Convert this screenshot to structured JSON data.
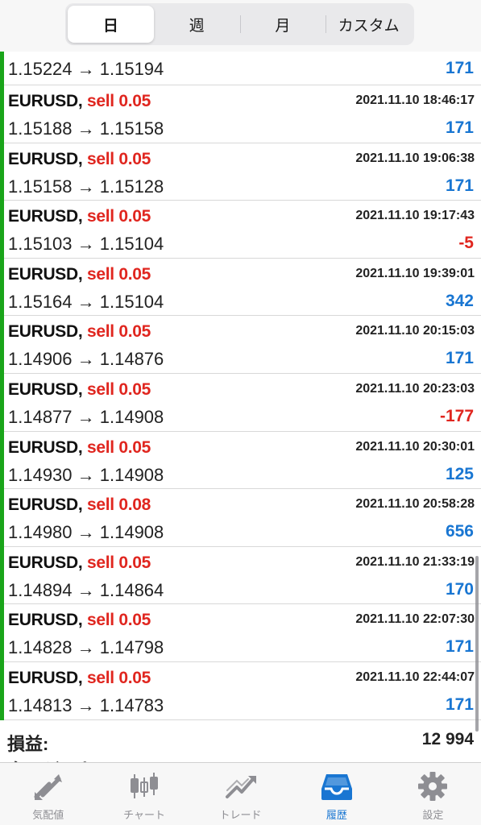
{
  "tabs_period": [
    "日",
    "週",
    "月",
    "カスタム"
  ],
  "active_period": "日",
  "first_partial": {
    "prices": "1.15224 → 1.15194",
    "profit": "171"
  },
  "deals": [
    {
      "symbol": "EURUSD,",
      "side": "sell 0.05",
      "time": "2021.11.10 18:46:17",
      "prices": "1.15188 → 1.15158",
      "profit": "171"
    },
    {
      "symbol": "EURUSD,",
      "side": "sell 0.05",
      "time": "2021.11.10 19:06:38",
      "prices": "1.15158 → 1.15128",
      "profit": "171"
    },
    {
      "symbol": "EURUSD,",
      "side": "sell 0.05",
      "time": "2021.11.10 19:17:43",
      "prices": "1.15103 → 1.15104",
      "profit": "-5"
    },
    {
      "symbol": "EURUSD,",
      "side": "sell 0.05",
      "time": "2021.11.10 19:39:01",
      "prices": "1.15164 → 1.15104",
      "profit": "342"
    },
    {
      "symbol": "EURUSD,",
      "side": "sell 0.05",
      "time": "2021.11.10 20:15:03",
      "prices": "1.14906 → 1.14876",
      "profit": "171"
    },
    {
      "symbol": "EURUSD,",
      "side": "sell 0.05",
      "time": "2021.11.10 20:23:03",
      "prices": "1.14877 → 1.14908",
      "profit": "-177"
    },
    {
      "symbol": "EURUSD,",
      "side": "sell 0.05",
      "time": "2021.11.10 20:30:01",
      "prices": "1.14930 → 1.14908",
      "profit": "125"
    },
    {
      "symbol": "EURUSD,",
      "side": "sell 0.08",
      "time": "2021.11.10 20:58:28",
      "prices": "1.14980 → 1.14908",
      "profit": "656"
    },
    {
      "symbol": "EURUSD,",
      "side": "sell 0.05",
      "time": "2021.11.10 21:33:19",
      "prices": "1.14894 → 1.14864",
      "profit": "170"
    },
    {
      "symbol": "EURUSD,",
      "side": "sell 0.05",
      "time": "2021.11.10 22:07:30",
      "prices": "1.14828 → 1.14798",
      "profit": "171"
    },
    {
      "symbol": "EURUSD,",
      "side": "sell 0.05",
      "time": "2021.11.10 22:44:07",
      "prices": "1.14813 → 1.14783",
      "profit": "171"
    }
  ],
  "summary": {
    "label": "損益:",
    "value": "12 994",
    "next_label": "クレジット"
  },
  "tabbar": [
    {
      "label": "気配値",
      "icon": "quotes-icon"
    },
    {
      "label": "チャート",
      "icon": "chart-icon"
    },
    {
      "label": "トレード",
      "icon": "trade-icon"
    },
    {
      "label": "履歴",
      "icon": "history-icon"
    },
    {
      "label": "設定",
      "icon": "settings-icon"
    }
  ],
  "active_tab": "履歴",
  "colors": {
    "buy_bar": "#1aa51a",
    "sell": "#e0261f",
    "profit_pos": "#1976d2",
    "profit_neg": "#e0261f",
    "accent": "#1976d2"
  }
}
